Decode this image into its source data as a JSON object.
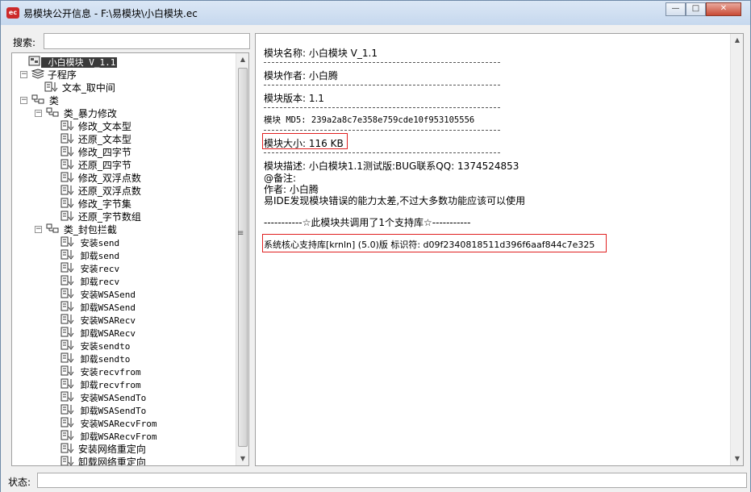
{
  "window": {
    "title": "易模块公开信息 - F:\\易模块\\小白模块.ec",
    "app_icon_text": "ec",
    "minimize_glyph": "—",
    "maximize_glyph": "□",
    "close_glyph": "✕"
  },
  "search": {
    "label": "搜索:",
    "value": ""
  },
  "tree": {
    "root": "小白模块 V_1.1",
    "subprograms": "子程序",
    "sub_items": [
      "文本_取中间"
    ],
    "classes": "类",
    "class1": {
      "name": "类_暴力修改",
      "items": [
        "修改_文本型",
        "还原_文本型",
        "修改_四字节",
        "还原_四字节",
        "修改_双浮点数",
        "还原_双浮点数",
        "修改_字节集",
        "还原_字节数组"
      ]
    },
    "class2": {
      "name": "类_封包拦截",
      "items": [
        "安装send",
        "卸载send",
        "安装recv",
        "卸载recv",
        "安装WSASend",
        "卸载WSASend",
        "安装WSARecv",
        "卸载WSARecv",
        "安装sendto",
        "卸载sendto",
        "安装recvfrom",
        "卸载recvfrom",
        "安装WSASendTo",
        "卸载WSASendTo",
        "安装WSARecvFrom",
        "卸载WSARecvFrom",
        "安装网络重定向",
        "卸载网络重定向"
      ]
    }
  },
  "details": {
    "name_line": "模块名称: 小白模块 V_1.1",
    "author_line": "模块作者: 小白腾",
    "version_line": "模块版本: 1.1",
    "md5_line": "模块 MD5: 239a2a8c7e358e759cde10f953105556",
    "size_line": "模块大小: 116 KB",
    "desc_line": "模块描述: 小白模块1.1测试版:BUG联系QQ: 1374524853",
    "remark_line": "@备注:",
    "remark_author": "作者: 小白腾",
    "remark_text": "易IDE发现模块错误的能力太差,不过大多数功能应该可以使用",
    "libs_header": "-----------☆此模块共调用了1个支持库☆-----------",
    "lib_line": "系统核心支持库[krnln] (5.0)版 标识符: d09f2340818511d396f6aaf844c7e325"
  },
  "status": {
    "label": "状态:",
    "value": ""
  }
}
